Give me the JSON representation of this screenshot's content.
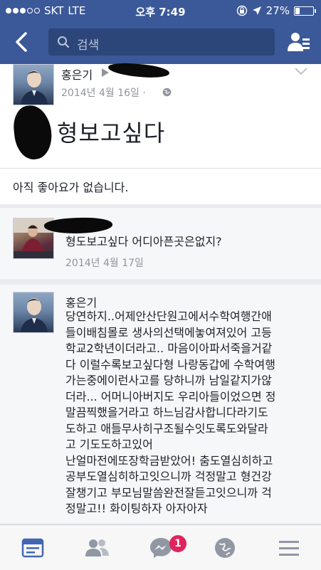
{
  "status_bar": {
    "carrier": "SKT",
    "network": "LTE",
    "time": "오후 7:49",
    "battery": "27%",
    "battery_level": 0.27
  },
  "nav": {
    "search_placeholder": "검색"
  },
  "post": {
    "author": "홍은기",
    "date": "2014년 4월 16일 ·",
    "text": "형보고싶다",
    "likes_text": "아직 좋아요가 없습니다."
  },
  "comments": [
    {
      "text": "형도보고싶다 어디아픈곳은없지?",
      "date": "2014년 4월 17일"
    },
    {
      "author": "홍은기",
      "lines": [
        "당연하지..어제안산단원고에서수학여행간애",
        "들이배침몰로 생사의선택에놓여져있어 고등",
        "학교2학년이더라고.. 마음이아파서죽을거같",
        "다 이럴수록보고싶다형 나랑동갑에 수학여행",
        "가는중에이런사고를 당하니까 남일같지가않",
        "더라... 어머니아버지도 우리아들이었으면 정",
        "말끔찍했을거라고 하느님감사합니다라기도",
        "도하고 애들무사히구조될수잇도록도와달라",
        "고 기도도하고있어",
        "난얼마전에또장학금받았어! 춤도열심히하고",
        "공부도열심히하고잇으니까 걱정말고 형건강",
        "잘챙기고 부모님말씀완전잘듣고잇으니까 걱",
        "정말고!! 화이팅하자 아자아자"
      ]
    }
  ],
  "tabbar": {
    "messages_badge": "1"
  },
  "colors": {
    "brand": "#3b5998",
    "badge": "#e0245e",
    "meta": "#90949c"
  }
}
